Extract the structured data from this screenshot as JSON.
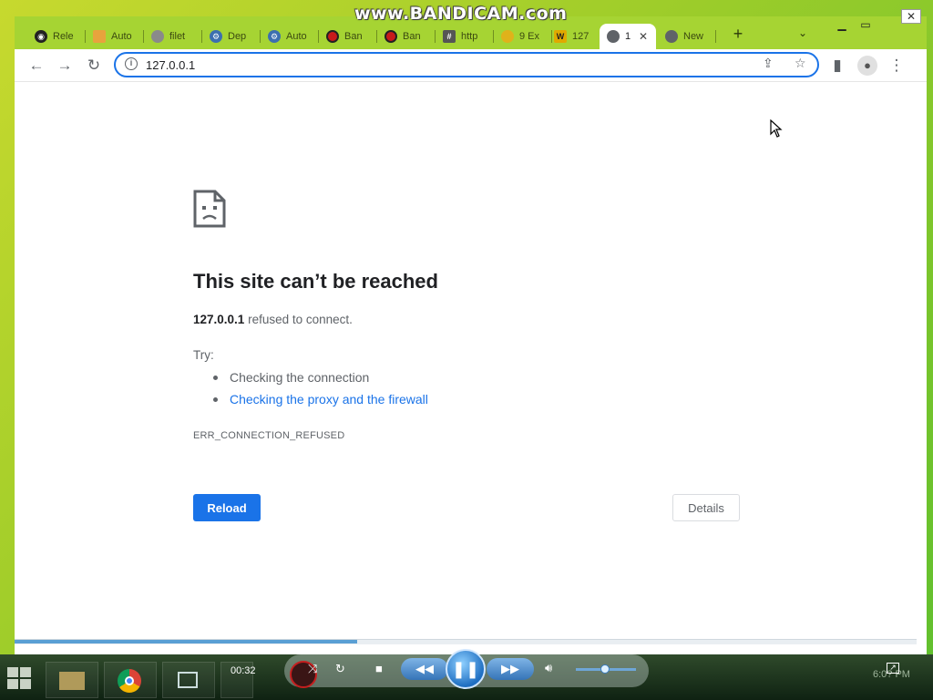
{
  "watermark": "www.BANDICAM.com",
  "tabs": [
    {
      "title": "Rele",
      "favicon": "github-icon",
      "color": "#222222"
    },
    {
      "title": "Auto",
      "favicon": "folder-icon",
      "color": "#e8a33d"
    },
    {
      "title": "filet",
      "favicon": "globe-icon",
      "color": "#8a8a8a"
    },
    {
      "title": "Dep",
      "favicon": "deploy-icon",
      "color": "#3c6fb0"
    },
    {
      "title": "Auto",
      "favicon": "deploy-icon",
      "color": "#3c6fb0"
    },
    {
      "title": "Ban",
      "favicon": "record-icon",
      "color": "#c81b1b"
    },
    {
      "title": "Ban",
      "favicon": "record-icon",
      "color": "#c81b1b"
    },
    {
      "title": "http",
      "favicon": "grid-icon",
      "color": "#555555"
    },
    {
      "title": "9 Ex",
      "favicon": "bulb-icon",
      "color": "#e0b21a"
    },
    {
      "title": "127",
      "favicon": "w-icon",
      "color": "#e0a900"
    },
    {
      "title": "1",
      "favicon": "globe-icon",
      "color": "#5f6368"
    },
    {
      "title": "New",
      "favicon": "chrome-icon",
      "color": "#5f6368"
    }
  ],
  "address_bar": {
    "url": "127.0.0.1"
  },
  "error_page": {
    "title": "This site can’t be reached",
    "host": "127.0.0.1",
    "message": "refused to connect.",
    "try_label": "Try:",
    "suggestions": [
      "Checking the connection",
      "Checking the proxy and the firewall"
    ],
    "error_code": "ERR_CONNECTION_REFUSED",
    "reload_label": "Reload",
    "details_label": "Details"
  },
  "media_player": {
    "elapsed": "00:32",
    "seek_progress": 0.38,
    "volume": 0.5
  },
  "tray": {
    "time": "6:0? PM"
  },
  "colors": {
    "accent": "#1a73e8",
    "tab_strip": "#a6d433",
    "text_secondary": "#5f6368"
  }
}
